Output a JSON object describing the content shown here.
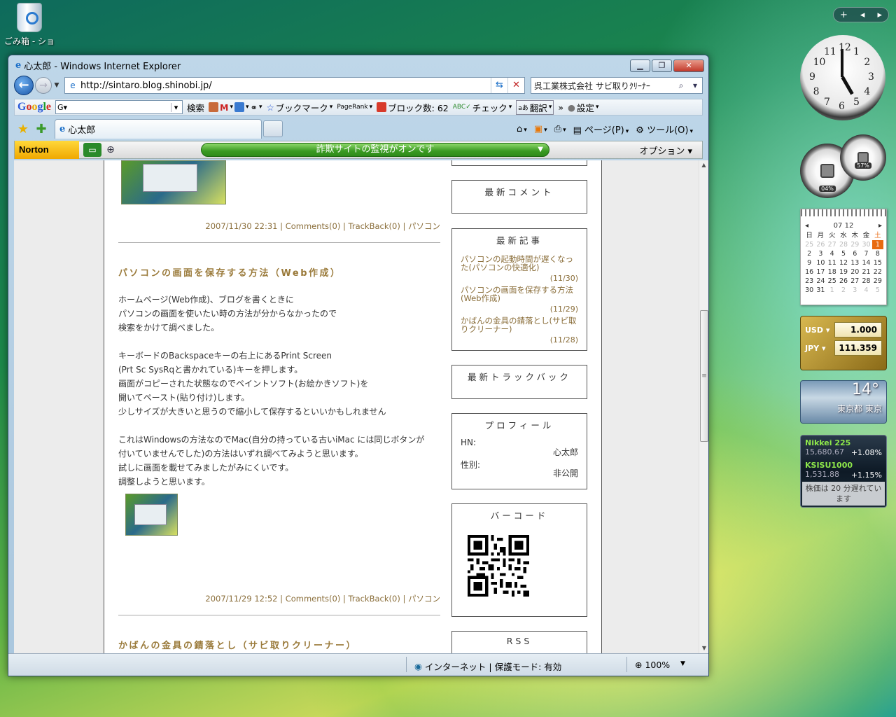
{
  "desktop": {
    "recycle_label": "ごみ箱 - ショ"
  },
  "window": {
    "title": "心太郎 - Windows Internet Explorer",
    "url": "http://sintaro.blog.shinobi.jp/",
    "search_text": "呉工業株式会社 サビ取りｸﾘｰﾅｰ"
  },
  "google_bar": {
    "logo": [
      "G",
      "o",
      "o",
      "g",
      "l",
      "e"
    ],
    "search_label": "検索",
    "bookmarks_label": "ブックマーク",
    "pagerank_label": "PageRank",
    "blocked_label": "ブロック数: 62",
    "check_label": "チェック",
    "translate_label": "翻訳",
    "settings_label": "設定"
  },
  "tabs": [
    {
      "label": "心太郎"
    }
  ],
  "command_bar": {
    "page_label": "ページ(P)",
    "tools_label": "ツール(O)"
  },
  "norton": {
    "logo": "Norton",
    "status": "詐欺サイトの監視がオンです",
    "options_label": "オプション"
  },
  "posts": [
    {
      "meta_date": "2007/11/30 22:31",
      "meta_comments": "Comments(0)",
      "meta_trackback": "TrackBack(0)",
      "meta_category": "パソコン"
    },
    {
      "title": "パソコンの画面を保存する方法（Web作成）",
      "body": [
        "ホームページ(Web作成)、ブログを書くときに",
        "パソコンの画面を使いたい時の方法が分からなかったので",
        "検索をかけて調べました。",
        "",
        "キーボードのBackspaceキーの右上にあるPrint Screen",
        "(Prt Sc SysRqと書かれている)キーを押します。",
        "画面がコピーされた状態なのでペイントソフト(お絵かきソフト)を",
        "開いてペースト(貼り付け)します。",
        "少しサイズが大きいと思うので縮小して保存するといいかもしれません",
        "",
        "これはWindowsの方法なのでMac(自分の持っている古いiMac には同じボタンが",
        "付いていませんでした)の方法はいずれ調べてみようと思います。",
        "試しに画面を載せてみましたがみにくいです。",
        "調整しようと思います。"
      ],
      "meta_date": "2007/11/29 12:52",
      "meta_comments": "Comments(0)",
      "meta_trackback": "TrackBack(0)",
      "meta_category": "パソコン"
    },
    {
      "title": "かばんの金具の錆落とし（サビ取りクリーナー）"
    }
  ],
  "meta_sep": "|",
  "sidebar": {
    "recent_comments_title": "最新コメント",
    "recent_articles_title": "最新記事",
    "recent_articles": [
      {
        "title": "パソコンの起動時間が遅くなった(パソコンの快適化)",
        "date": "(11/30)"
      },
      {
        "title": "パソコンの画面を保存する方法(Web作成)",
        "date": "(11/29)"
      },
      {
        "title": "かばんの金具の錆落とし(サビ取りクリーナー)",
        "date": "(11/28)"
      }
    ],
    "recent_trackback_title": "最新トラックバック",
    "profile_title": "プロフィール",
    "profile_hn_label": "HN:",
    "profile_hn_value": "心太郎",
    "profile_sex_label": "性別:",
    "profile_sex_value": "非公開",
    "barcode_title": "バーコード",
    "rss_title": "RSS"
  },
  "statusbar": {
    "zone": "インターネット | 保護モード: 有効",
    "zoom": "100%"
  },
  "gadgets": {
    "clock_numbers": [
      "12",
      "1",
      "2",
      "3",
      "4",
      "5",
      "6",
      "7",
      "8",
      "9",
      "10",
      "11"
    ],
    "cpu_pct": "04%",
    "mem_pct": "57%",
    "calendar": {
      "month": "07 12",
      "weekdays": [
        "日",
        "月",
        "火",
        "水",
        "木",
        "金",
        "土"
      ],
      "days": [
        [
          "25",
          "26",
          "27",
          "28",
          "29",
          "30",
          "1"
        ],
        [
          "2",
          "3",
          "4",
          "5",
          "6",
          "7",
          "8"
        ],
        [
          "9",
          "10",
          "11",
          "12",
          "13",
          "14",
          "15"
        ],
        [
          "16",
          "17",
          "18",
          "19",
          "20",
          "21",
          "22"
        ],
        [
          "23",
          "24",
          "25",
          "26",
          "27",
          "28",
          "29"
        ],
        [
          "30",
          "31",
          "1",
          "2",
          "3",
          "4",
          "5"
        ]
      ]
    },
    "currency": [
      {
        "code": "USD",
        "value": "1.000"
      },
      {
        "code": "JPY",
        "value": "111.359"
      }
    ],
    "weather": {
      "temp": "14°",
      "location": "東京都 東京"
    },
    "stocks": [
      {
        "name": "Nikkei 225",
        "value": "15,680.67",
        "change": "+1.08%"
      },
      {
        "name": "KSISU1000",
        "value": "1,531.88",
        "change": "+1.15%"
      }
    ],
    "stock_note": "株価は 20 分遅れています"
  },
  "colors": {
    "accent_link": "#8a6e3a",
    "norton_green": "#3a9a22",
    "today": "#e86a10"
  }
}
